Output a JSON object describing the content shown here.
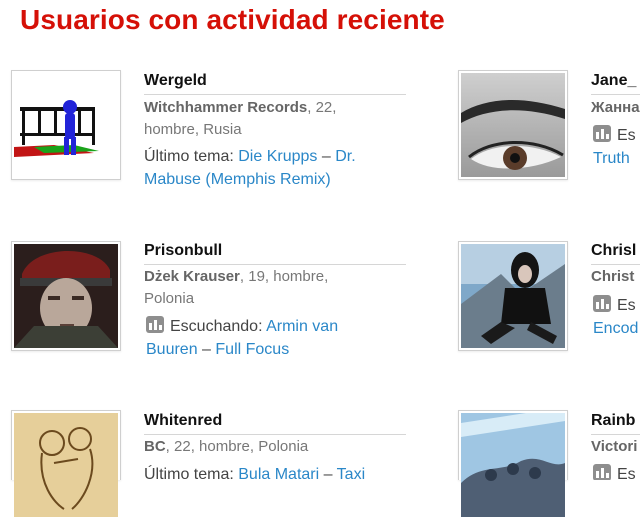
{
  "page_title": "Usuarios con actividad reciente",
  "colors": {
    "title": "#d51007",
    "link": "#2a87c8"
  },
  "users": [
    {
      "username": "Wergeld",
      "meta_bold": "Witchhammer Records",
      "meta_rest_1": ", 22,",
      "meta_rest_2": "hombre, Rusia",
      "activity_label": "Último tema: ",
      "artist": "Die Krupps",
      "sep": " – ",
      "track_1": "Dr.",
      "track_2": "Mabuse (Memphis Remix)",
      "icon": null
    },
    {
      "username": "Jane_",
      "meta_bold": "Жанна",
      "activity_icon_text": "Es",
      "link_fragment": "Truth",
      "icon": "scrobble-bars-icon"
    },
    {
      "username": "Prisonbull",
      "meta_bold": "Dżek Krauser",
      "meta_rest_1": ", 19, hombre,",
      "meta_rest_2": "Polonia",
      "activity_label": "Escuchando: ",
      "artist_1": "Armin van",
      "artist_2": "Buuren",
      "sep": " – ",
      "track": "Full Focus",
      "icon": "scrobble-bars-icon"
    },
    {
      "username": "Chrisl",
      "meta_bold": "Christ",
      "activity_icon_text": "Es",
      "link_fragment": "Encod",
      "icon": "scrobble-bars-icon"
    },
    {
      "username": "Whitenred",
      "meta_bold": "BC",
      "meta_rest_1": ", 22, hombre, Polonia",
      "activity_label": "Último tema: ",
      "artist": "Bula Matari",
      "sep": " – ",
      "track": "Taxi",
      "icon": null
    },
    {
      "username": "Rainb",
      "meta_bold": "Victori",
      "activity_icon_text": "Es",
      "icon": "scrobble-bars-icon"
    }
  ]
}
